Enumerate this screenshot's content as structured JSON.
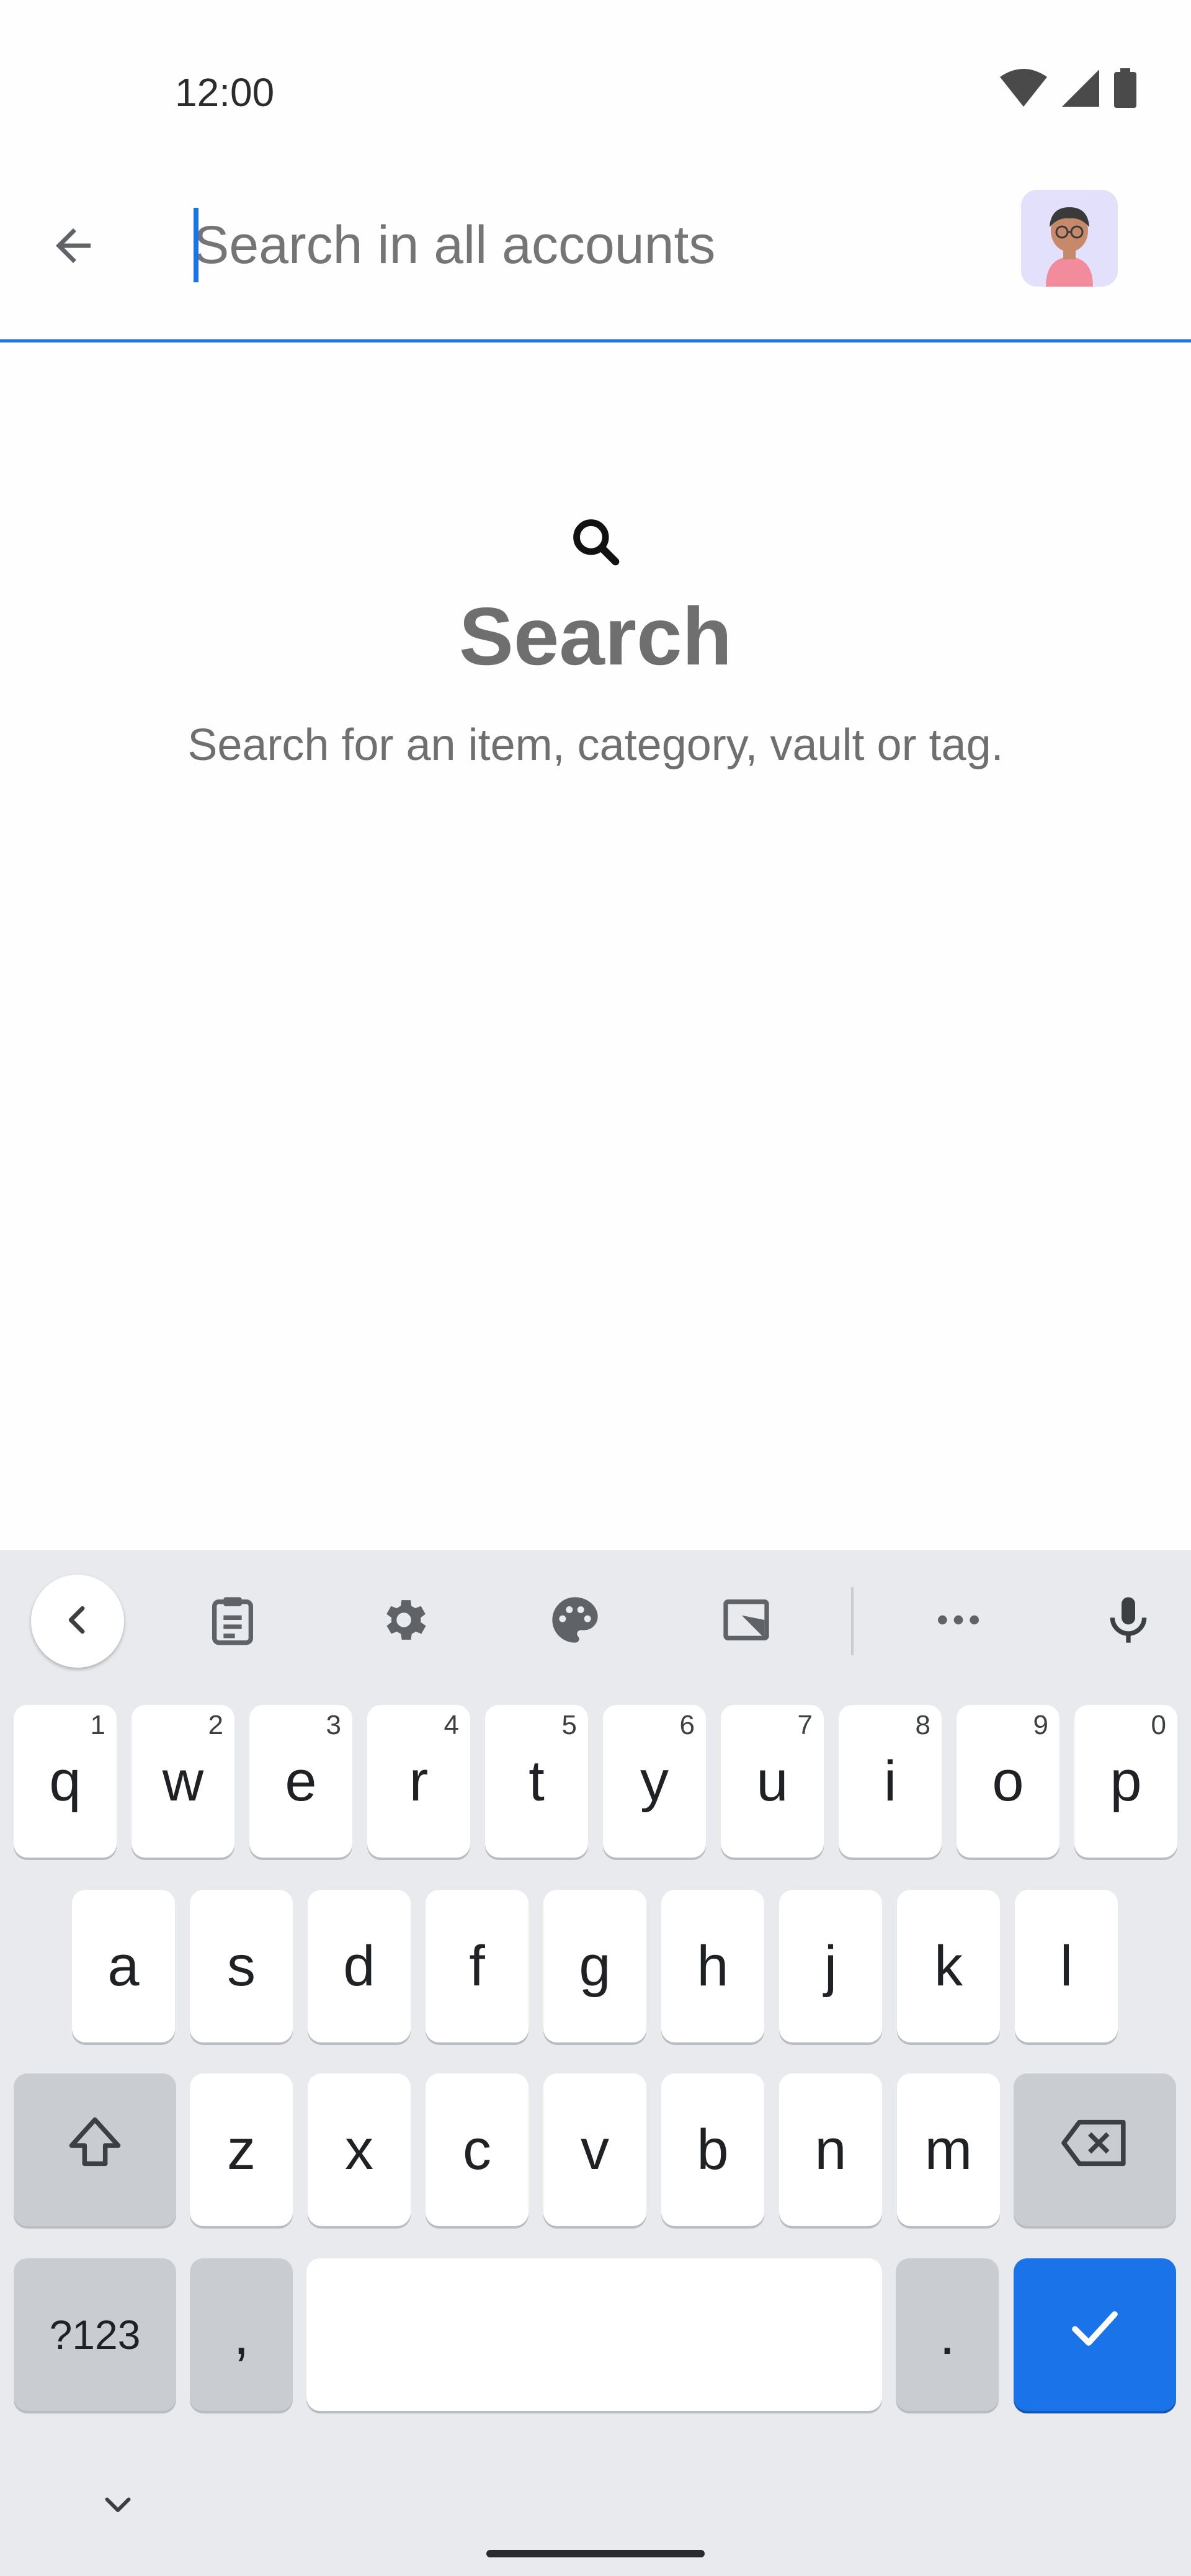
{
  "status_bar": {
    "time": "12:00",
    "icons": [
      "wifi-icon",
      "cell-signal-icon",
      "battery-icon"
    ]
  },
  "search": {
    "placeholder": "Search in all accounts",
    "value": ""
  },
  "empty_state": {
    "icon": "search-icon",
    "title": "Search",
    "description": "Search for an item, category, vault or tag."
  },
  "keyboard": {
    "toolbar": [
      "collapse-icon",
      "clipboard-icon",
      "gear-icon",
      "palette-icon",
      "resize-icon",
      "more-icon",
      "mic-icon"
    ],
    "row1": [
      {
        "key": "q",
        "hint": "1"
      },
      {
        "key": "w",
        "hint": "2"
      },
      {
        "key": "e",
        "hint": "3"
      },
      {
        "key": "r",
        "hint": "4"
      },
      {
        "key": "t",
        "hint": "5"
      },
      {
        "key": "y",
        "hint": "6"
      },
      {
        "key": "u",
        "hint": "7"
      },
      {
        "key": "i",
        "hint": "8"
      },
      {
        "key": "o",
        "hint": "9"
      },
      {
        "key": "p",
        "hint": "0"
      }
    ],
    "row2": [
      "a",
      "s",
      "d",
      "f",
      "g",
      "h",
      "j",
      "k",
      "l"
    ],
    "row3": [
      "z",
      "x",
      "c",
      "v",
      "b",
      "n",
      "m"
    ],
    "symbols_label": "?123",
    "comma": ",",
    "period": "."
  },
  "colors": {
    "accent": "#1a73e8",
    "keyboard_bg": "#e8eaed",
    "key_bg": "#ffffff",
    "key_dark_bg": "#c9ccd1",
    "text_muted": "#6f6f6f"
  }
}
